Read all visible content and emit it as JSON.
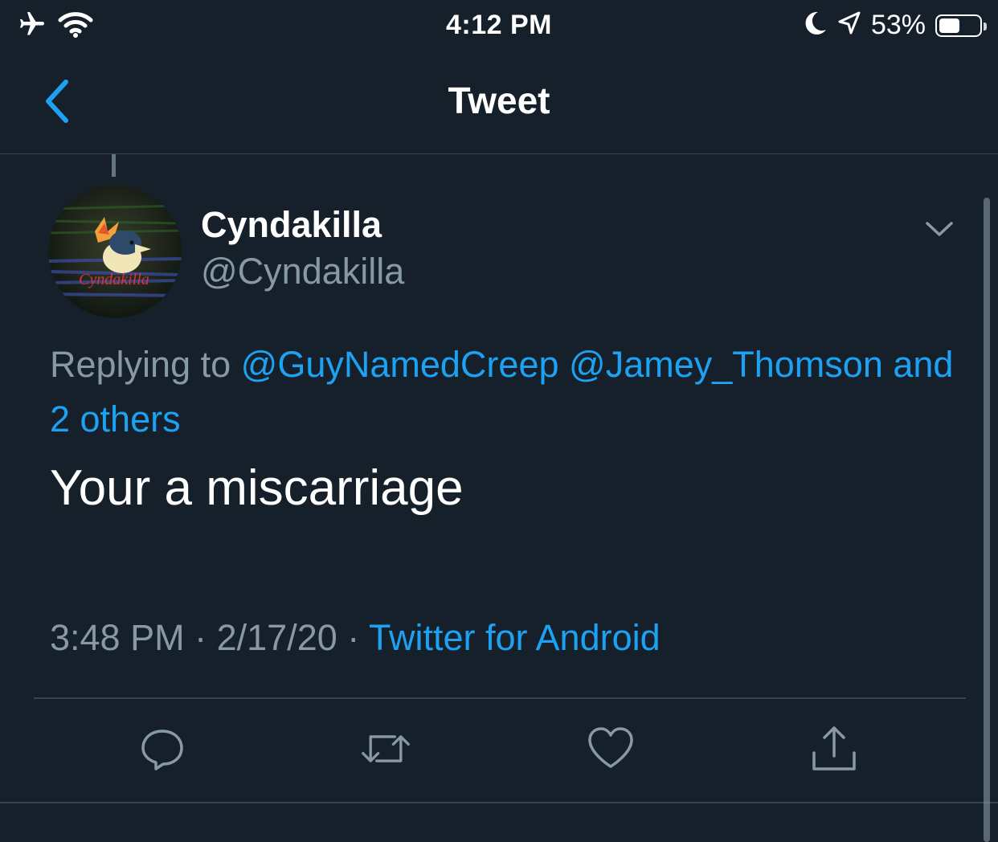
{
  "status_bar": {
    "time": "4:12 PM",
    "battery_percent": "53%",
    "battery_level": 0.53,
    "icons": [
      "airplane-icon",
      "wifi-icon",
      "moon-icon",
      "location-arrow-icon",
      "battery-icon"
    ]
  },
  "nav": {
    "title": "Tweet",
    "back_icon": "chevron-left-icon"
  },
  "tweet": {
    "display_name": "Cyndakilla",
    "handle": "@Cyndakilla",
    "replying_prefix": "Replying to",
    "mentions": [
      "@GuyNamedCreep",
      "@Jamey_Thomson"
    ],
    "others": "and 2 others",
    "text": "Your a miscarriage",
    "time": "3:48 PM",
    "date": "2/17/20",
    "separator": "·",
    "source": "Twitter for Android"
  },
  "actions": [
    "reply-icon",
    "retweet-icon",
    "like-icon",
    "share-icon"
  ],
  "colors": {
    "background": "#15202b",
    "accent": "#1da1f2",
    "secondary_text": "#8899a6",
    "divider": "#38444d"
  }
}
